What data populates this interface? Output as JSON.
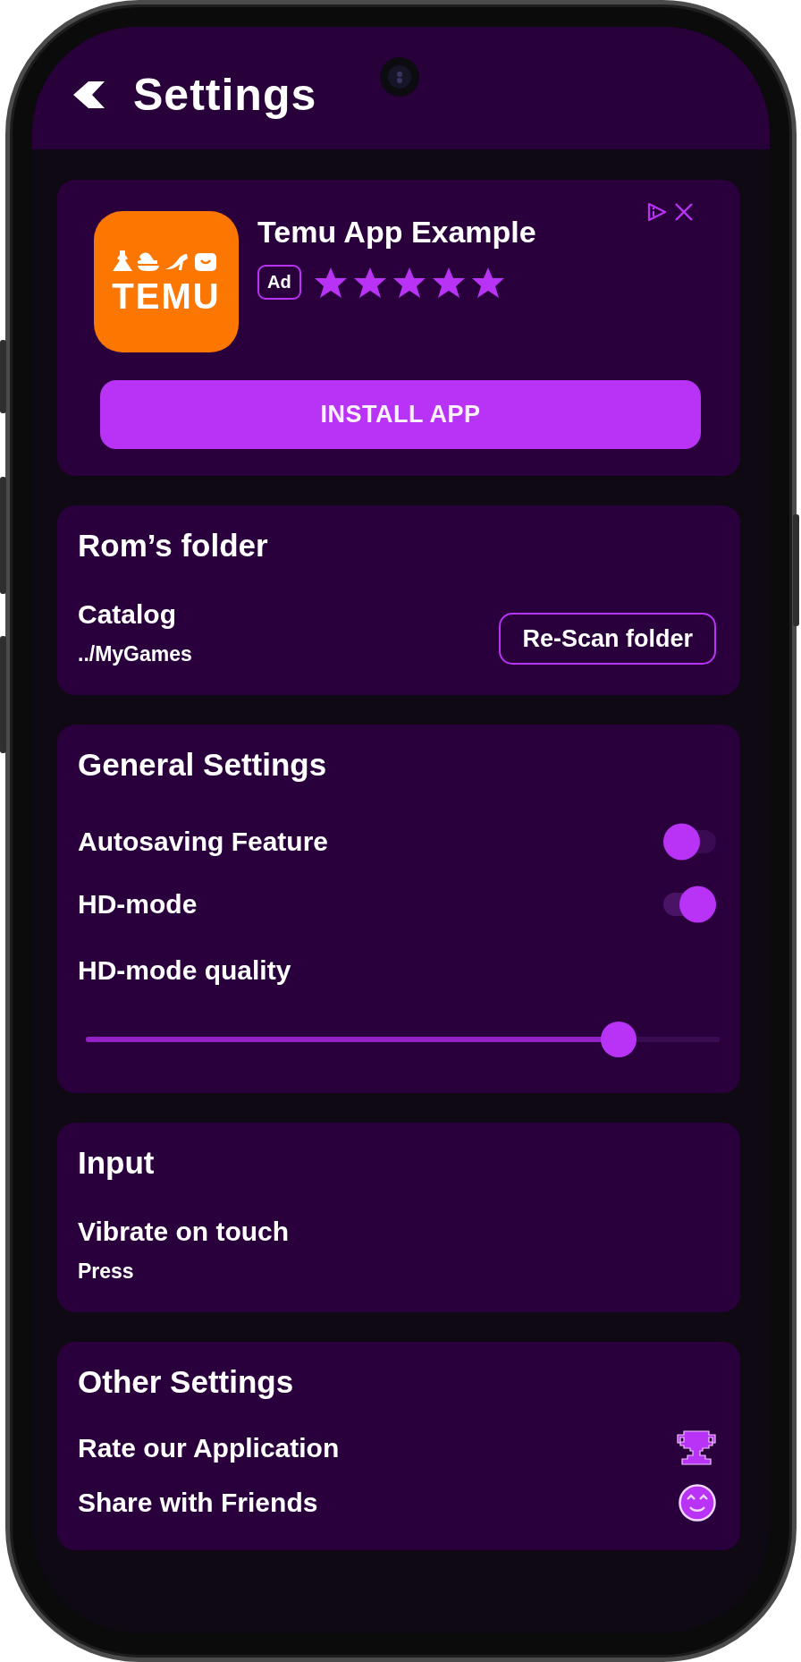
{
  "header": {
    "title": "Settings"
  },
  "ad": {
    "logo_text": "TEMU",
    "app_name": "Temu App Example",
    "badge": "Ad",
    "stars": 5,
    "button": "INSTALL APP"
  },
  "sections": [
    {
      "title": "Rom’s folder",
      "rows": [
        {
          "kind": "folder",
          "label": "Catalog",
          "value": "../MyGames",
          "button": "Re-Scan folder"
        }
      ]
    },
    {
      "title": "General Settings",
      "rows": [
        {
          "kind": "toggle",
          "label": "Autosaving Feature",
          "on": false
        },
        {
          "kind": "toggle",
          "label": "HD-mode",
          "on": true
        },
        {
          "kind": "slider",
          "label": "HD-mode quality",
          "level": 0.84
        }
      ]
    },
    {
      "title": "Input",
      "rows": [
        {
          "kind": "value",
          "label": "Vibrate on touch",
          "value": "Press"
        }
      ]
    },
    {
      "title": "Other Settings",
      "rows": [
        {
          "kind": "rate",
          "label": "Rate our Application"
        },
        {
          "kind": "share",
          "label": "Share with Friends"
        }
      ]
    }
  ]
}
